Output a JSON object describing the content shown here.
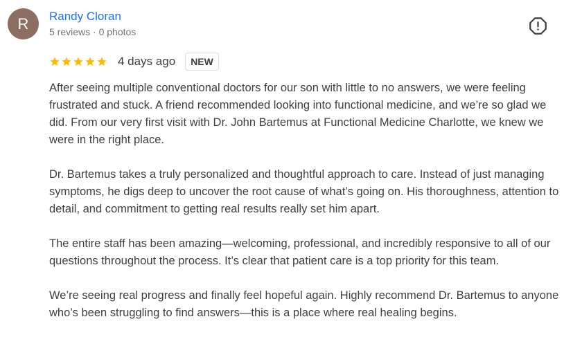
{
  "reviewer": {
    "avatar_letter": "R",
    "avatar_color": "#8d6e63",
    "name": "Randy Cloran",
    "meta": "5 reviews · 0 photos"
  },
  "rating": {
    "stars": 5,
    "max_stars": 5,
    "star_color": "#fbbc04",
    "time_ago": "4 days ago",
    "badge": "NEW"
  },
  "report_icon": "report-flag-icon",
  "review": {
    "paragraphs": [
      "After seeing multiple conventional doctors for our son with little to no answers, we were feeling frustrated and stuck. A friend recommended looking into functional medicine, and we’re so glad we did. From our very first visit with Dr. John Bartemus at Functional Medicine Charlotte, we knew we were in the right place.",
      "Dr. Bartemus takes a truly personalized and thoughtful approach to care. Instead of just managing symptoms, he digs deep to uncover the root cause of what’s going on. His thoroughness, attention to detail, and commitment to getting real results really set him apart.",
      "The entire staff has been amazing—welcoming, professional, and incredibly responsive to all of our questions throughout the process. It’s clear that patient care is a top priority for this team.",
      "We’re seeing real progress and finally feel hopeful again. Highly recommend Dr. Bartemus to anyone who’s been struggling to find answers—this is a place where real healing begins."
    ]
  }
}
